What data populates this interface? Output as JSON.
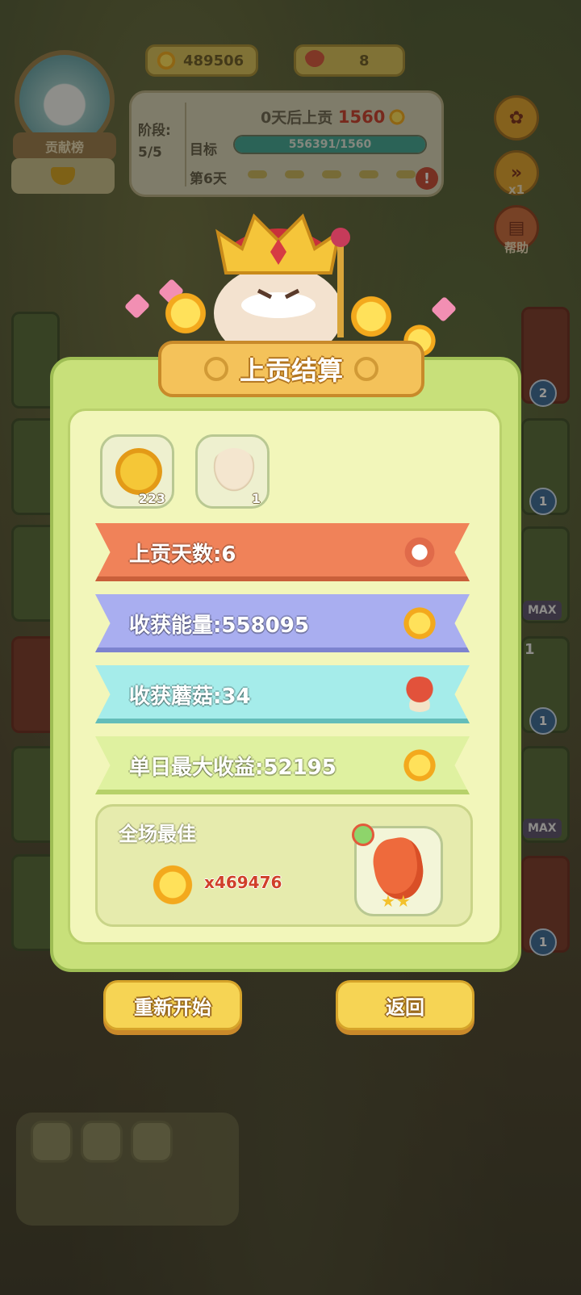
{
  "hud": {
    "sun_count": "489506",
    "mushroom_count": "8",
    "rank_label": "贡献榜"
  },
  "stage": {
    "stage_label": "阶段:",
    "stage_value": "5/5",
    "tribute_prefix": "0天后上贡",
    "tribute_amount": "1560",
    "target_label": "目标",
    "target_progress_text": "556391/1560",
    "target_progress_fraction": 1.0,
    "day_label": "第6天",
    "warn_icon": "!"
  },
  "side_buttons": {
    "settings_icon": "gear-icon",
    "speed_label": "x1",
    "help_label": "帮助"
  },
  "edge_tiles": {
    "badges": [
      "2",
      "1",
      "1",
      "1"
    ],
    "max_labels": [
      "MAX",
      "MAX"
    ],
    "partial_count": "1"
  },
  "result": {
    "title": "上贡结算",
    "rewards": [
      {
        "icon": "gold-mushroom-coin-icon",
        "count": "223"
      },
      {
        "icon": "mushroom-egg-icon",
        "count": "1"
      }
    ],
    "rows": [
      {
        "label": "上贡天数:6",
        "icon": "stopwatch-icon",
        "color": "#f08259"
      },
      {
        "label": "收获能量:558095",
        "icon": "sun-icon",
        "color": "#a9aef0"
      },
      {
        "label": "收获蘑菇:34",
        "icon": "red-mushroom-icon",
        "color": "#a5ecea"
      },
      {
        "label": "单日最大收益:52195",
        "icon": "sun-icon",
        "color": "#dff1a0"
      }
    ],
    "best": {
      "title": "全场最佳",
      "value": "x469476",
      "character": "pepper-character",
      "stars": "★★"
    }
  },
  "buttons": {
    "restart": "重新开始",
    "back": "返回"
  },
  "colors": {
    "panel_green": "#c8e07a",
    "button_yellow": "#f6d454",
    "accent_red": "#c83d2c"
  }
}
